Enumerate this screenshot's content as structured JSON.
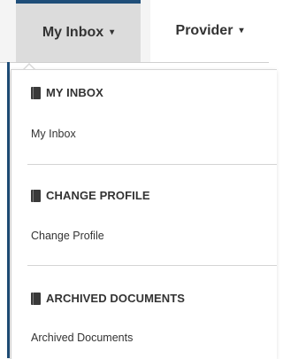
{
  "nav": {
    "tabs": [
      {
        "label": "My Inbox",
        "caret": "▾"
      },
      {
        "label": "Provider",
        "caret": "▾"
      }
    ]
  },
  "dropdown": {
    "sections": [
      {
        "heading": "MY INBOX",
        "link": "My Inbox",
        "icon": "book-icon"
      },
      {
        "heading": "CHANGE PROFILE",
        "link": "Change Profile",
        "icon": "book-icon"
      },
      {
        "heading": "ARCHIVED DOCUMENTS",
        "link": "Archived Documents",
        "icon": "book-icon"
      }
    ]
  },
  "colors": {
    "accent": "#1f4e79",
    "active_tab_bg": "#dcdcdc",
    "text": "#333333"
  }
}
